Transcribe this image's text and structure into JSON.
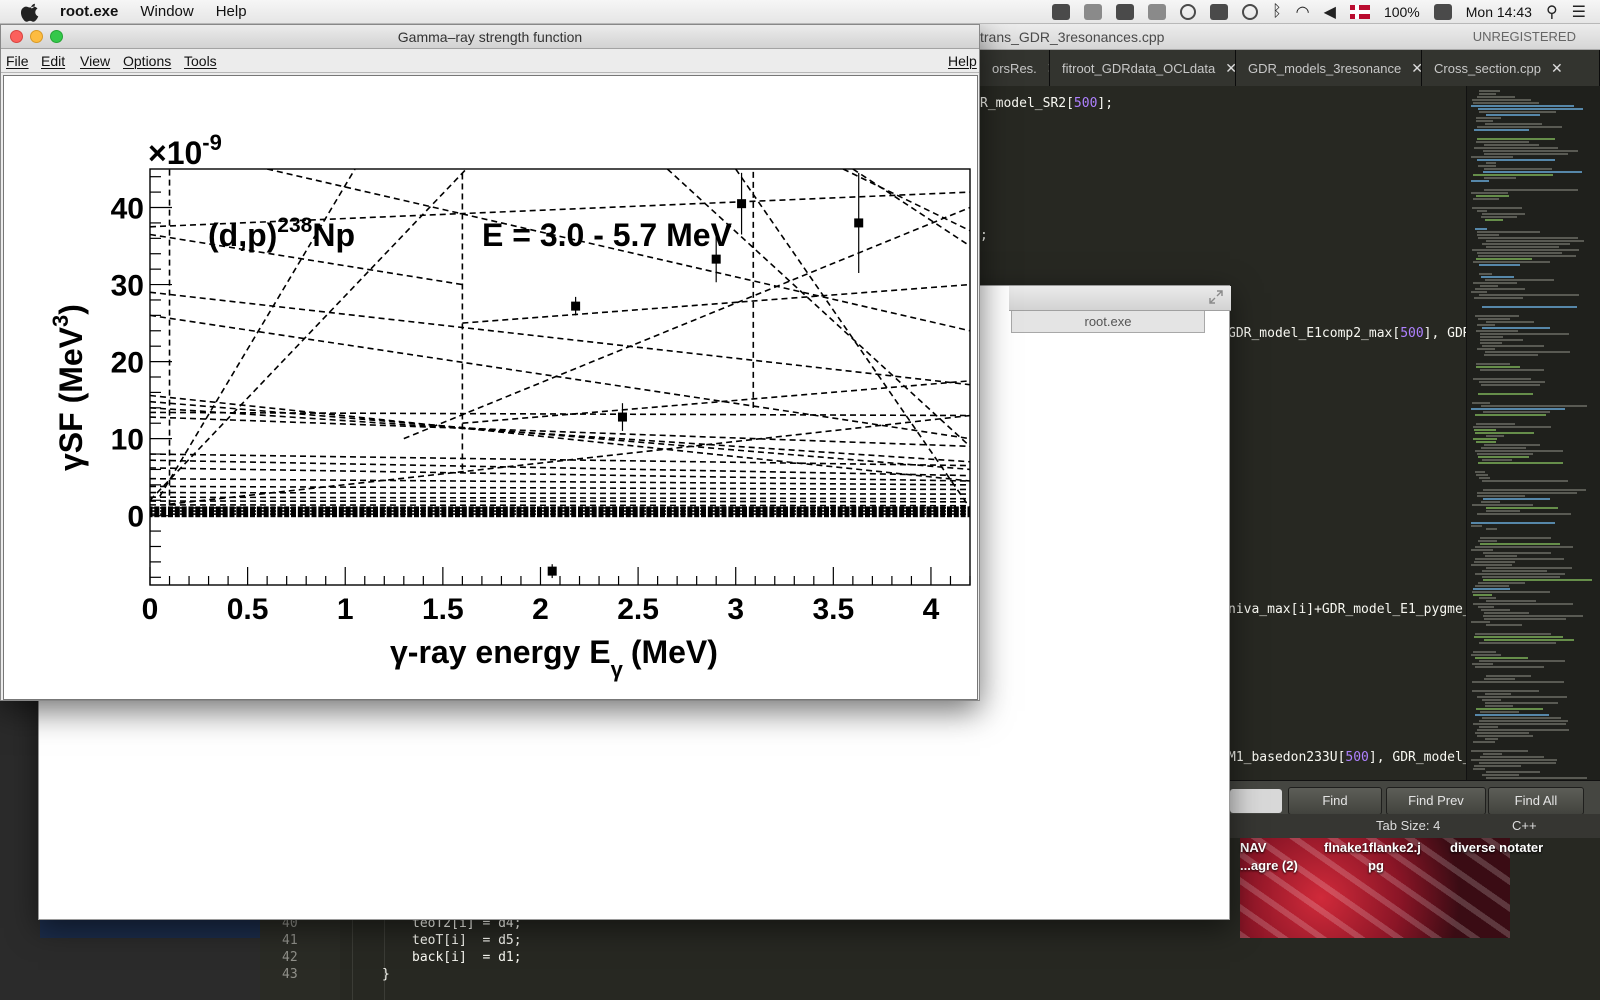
{
  "menubar": {
    "app_name": "root.exe",
    "menus": [
      "Window",
      "Help"
    ],
    "battery": "100%",
    "clock": "Mon 14:43"
  },
  "sublime": {
    "title_file": "trans_GDR_3resonances.cpp",
    "unregistered": "UNREGISTERED",
    "tabs": [
      "orsRes.",
      "fitroot_GDRdata_OCLdata",
      "GDR_models_3resonance",
      "Cross_section.cpp"
    ],
    "code_lines": [
      {
        "pre": "R_model_SR2[",
        "num": "500",
        "post": "];"
      },
      {
        "pre": ";",
        "num": "",
        "post": ""
      },
      {
        "pre": "GDR_model_E1comp2_max[",
        "num": "500",
        "post": "], GDR"
      },
      {
        "pre": "niva_max[i]+GDR_model_E1_pygme_",
        "num": "",
        "post": ""
      },
      {
        "pre": "M1_basedon233U[",
        "num": "500",
        "post": "], GDR_model_"
      }
    ],
    "find_buttons": [
      "Find",
      "Find Prev",
      "Find All"
    ],
    "status_tabsize": "Tab Size: 4",
    "status_language": "C++"
  },
  "desktop": {
    "labels": [
      "NAV",
      "...agre (2)",
      "flnake1flanke2.j",
      "pg",
      "diverse notater"
    ]
  },
  "bottom_editor": {
    "rows": [
      {
        "num": "40",
        "code": "teoT2[i] = d4;"
      },
      {
        "num": "41",
        "code": "teoT[i]  = d5;"
      },
      {
        "num": "42",
        "code": "back[i]  = d1;"
      },
      {
        "num": "43",
        "code": "}"
      }
    ]
  },
  "root_window": {
    "tab_label": "root.exe"
  },
  "canvas_window": {
    "title": "Gamma–ray strength function",
    "menu": [
      "File",
      "Edit",
      "View",
      "Options",
      "Tools"
    ],
    "help": "Help"
  },
  "chart_data": {
    "type": "scatter",
    "title": "",
    "exponent_label": "×10",
    "exponent_power": "-9",
    "xlabel": "γ-ray energy E",
    "xlabel_sub": "γ",
    "xlabel_unit": "(MeV)",
    "ylabel": "γSF (MeV",
    "ylabel_sup": "3",
    "ylabel_end": ")",
    "annotation_reaction": "(d,p)",
    "annotation_mass": "238",
    "annotation_nucleus": "Np",
    "annotation_energy": "E = 3.0 - 5.7 MeV",
    "xlim": [
      0,
      4.2
    ],
    "ylim": [
      -9,
      45
    ],
    "x_ticks": [
      0,
      0.5,
      1,
      1.5,
      2,
      2.5,
      3,
      3.5,
      4
    ],
    "x_tick_labels": [
      "0",
      "0.5",
      "1",
      "1.5",
      "2",
      "2.5",
      "3",
      "3.5",
      "4"
    ],
    "y_ticks": [
      0,
      10,
      20,
      30,
      40
    ],
    "y_tick_labels": [
      "0",
      "10",
      "20",
      "30",
      "40"
    ],
    "grid": false,
    "points": [
      {
        "x": 2.06,
        "y": -7.2,
        "err": 0.9
      },
      {
        "x": 2.18,
        "y": 27.2,
        "err": 1.2
      },
      {
        "x": 2.42,
        "y": 12.8,
        "err": 1.8
      },
      {
        "x": 2.9,
        "y": 33.3,
        "err": 3.0
      },
      {
        "x": 3.03,
        "y": 40.5,
        "err": 4.0
      },
      {
        "x": 3.63,
        "y": 38.0,
        "err": 6.5
      }
    ],
    "vertical_dashed_lines": [
      {
        "x": 0.1,
        "y_bottom": 0,
        "y_top": 45
      },
      {
        "x": 1.6,
        "y_bottom": 6,
        "y_top": 45
      },
      {
        "x": 3.09,
        "y_bottom": 14,
        "y_top": 45
      }
    ],
    "dashed_lines": [
      [
        0,
        37.5,
        4.2,
        42
      ],
      [
        0,
        36.5,
        1.6,
        30
      ],
      [
        0,
        29,
        4.2,
        17
      ],
      [
        0,
        26,
        4.2,
        10
      ],
      [
        0,
        15.6,
        4.2,
        4.5
      ],
      [
        0,
        14.8,
        4.2,
        6
      ],
      [
        0,
        14.0,
        4.2,
        7
      ],
      [
        0,
        13.4,
        4.2,
        13
      ],
      [
        0,
        12.8,
        4.2,
        9
      ],
      [
        0,
        8,
        4.2,
        6.5
      ],
      [
        0,
        7.2,
        4.2,
        5.2
      ],
      [
        0,
        6.2,
        4.2,
        4.5
      ],
      [
        0,
        4.8,
        4.2,
        4.0
      ],
      [
        0,
        3.8,
        4.2,
        3.4
      ],
      [
        0,
        3.0,
        4.2,
        2.8
      ],
      [
        0,
        2.4,
        4.2,
        2.2
      ],
      [
        0,
        1.9,
        4.2,
        1.8
      ],
      [
        0,
        1.4,
        4.2,
        1.3
      ],
      [
        0,
        1.0,
        4.2,
        1.0
      ],
      [
        0,
        0.6,
        4.2,
        0.6
      ],
      [
        0,
        0.2,
        4.2,
        0.2
      ],
      [
        0,
        2,
        1.62,
        45
      ],
      [
        0.05,
        2.5,
        1.05,
        45
      ],
      [
        0.1,
        1.5,
        4.2,
        13
      ],
      [
        1.6,
        12,
        4.2,
        17.5
      ],
      [
        0.6,
        45,
        4.2,
        24
      ],
      [
        2.65,
        45,
        4.2,
        9
      ],
      [
        3.0,
        45,
        4.2,
        1
      ],
      [
        3.6,
        45,
        4.2,
        35
      ],
      [
        3.55,
        45,
        4.2,
        37
      ],
      [
        1.3,
        10,
        4.2,
        40
      ],
      [
        1.6,
        25,
        4.2,
        30
      ]
    ]
  }
}
